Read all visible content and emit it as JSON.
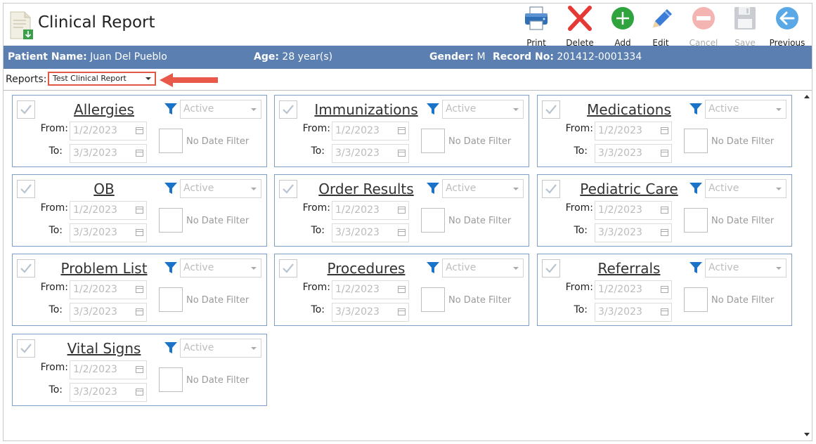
{
  "app": {
    "title": "Clinical Report",
    "icon": "report-document-icon"
  },
  "toolbar": {
    "print": {
      "label": "Print",
      "icon": "printer-icon",
      "enabled": true
    },
    "delete": {
      "label": "Delete",
      "icon": "red-x-icon",
      "enabled": true
    },
    "add": {
      "label": "Add",
      "icon": "green-plus-icon",
      "enabled": true
    },
    "edit": {
      "label": "Edit",
      "icon": "pencil-icon",
      "enabled": true
    },
    "cancel": {
      "label": "Cancel",
      "icon": "minus-circle-icon",
      "enabled": false
    },
    "save": {
      "label": "Save",
      "icon": "floppy-disk-icon",
      "enabled": false
    },
    "previous": {
      "label": "Previous",
      "icon": "back-arrow-icon",
      "enabled": true
    }
  },
  "patient": {
    "name_label": "Patient Name:",
    "name_value": "Juan Del Pueblo",
    "age_label": "Age:",
    "age_value": "28 year(s)",
    "gender_label": "Gender:",
    "gender_value": "M",
    "record_label": "Record No:",
    "record_value": "201412-0001334",
    "bar_color": "#5b7fb0"
  },
  "reports": {
    "label": "Reports:",
    "selected": "Test Clinical Report",
    "highlight_color": "#e05746"
  },
  "card_common": {
    "from_label": "From:",
    "to_label": "To:",
    "no_date_filter_label": "No Date Filter",
    "status": "Active",
    "from_date": "1/2/2023",
    "to_date": "3/3/2023",
    "filter_icon": "funnel-icon",
    "accent_color": "#1a73c8"
  },
  "cards": [
    {
      "title": "Allergies"
    },
    {
      "title": "Immunizations"
    },
    {
      "title": "Medications"
    },
    {
      "title": "OB"
    },
    {
      "title": "Order Results"
    },
    {
      "title": "Pediatric Care"
    },
    {
      "title": "Problem List"
    },
    {
      "title": "Procedures"
    },
    {
      "title": "Referrals"
    },
    {
      "title": "Vital Signs"
    }
  ]
}
